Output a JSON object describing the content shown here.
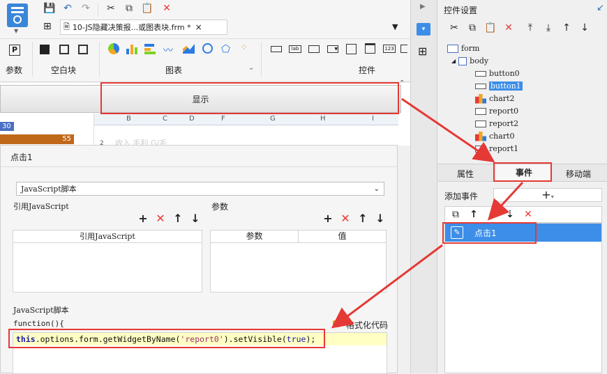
{
  "toolbar": {
    "doc_tab": "10-JS隐藏决策报...或图表块.frm *",
    "close_tab": "×",
    "group_params": "参数",
    "group_blank": "空白块",
    "group_chart": "图表",
    "group_widget": "控件"
  },
  "preview": {
    "display_button": "显示",
    "columns": [
      "B",
      "C",
      "D",
      "F",
      "G",
      "H",
      "I"
    ],
    "row_label": "2",
    "cell_ghost": "收入 毛利 G/毛",
    "bar1_value": "30",
    "bar2_value": "55"
  },
  "dialog": {
    "title": "点击1",
    "type_select": "JavaScript脚本",
    "ref_js_label": "引用JavaScript",
    "params_label": "参数",
    "ref_js_col": "引用JavaScript",
    "param_col": "参数",
    "value_col": "值",
    "script_label": "JavaScript脚本",
    "function_header": "function(){",
    "format_code": "格式化代码",
    "code_this": "this",
    "code_mid": ".options.form.getWidgetByName(",
    "code_arg": "'report0'",
    "code_mid2": ").setVisible(",
    "code_true": "true",
    "code_end": ");"
  },
  "right_panel": {
    "title": "控件设置",
    "tree": [
      "form",
      "body",
      "button0",
      "button1",
      "chart2",
      "report0",
      "report2",
      "chart0",
      "report1"
    ],
    "tabs": [
      "属性",
      "事件",
      "移动端"
    ],
    "add_event": "添加事件",
    "event_item": "点击1"
  },
  "colors": {
    "accent_red": "#e53935",
    "selected_blue": "#3c8ee8",
    "bar_orange": "#c0681a",
    "bar_blue": "#4a6fc4"
  }
}
